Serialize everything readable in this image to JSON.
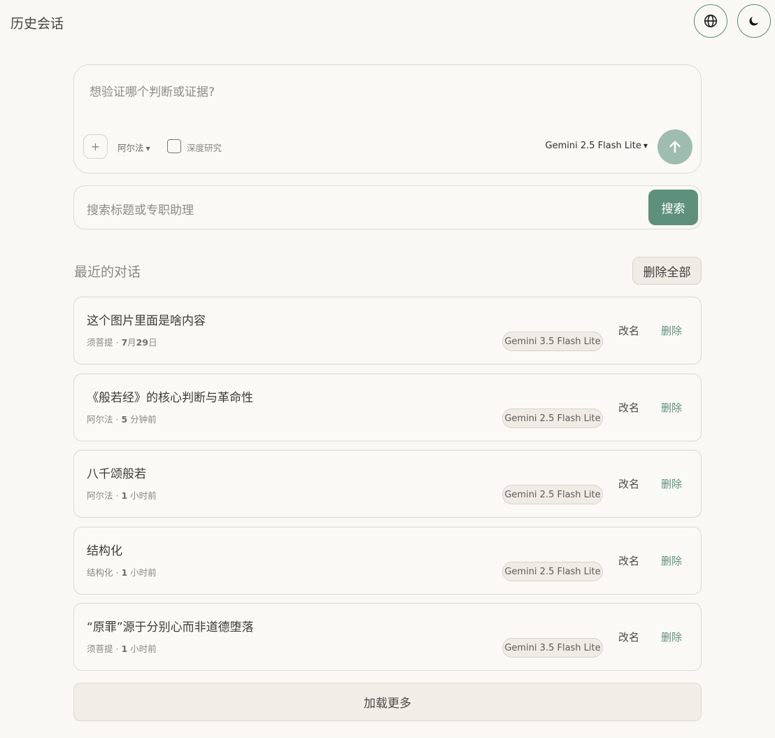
{
  "header": {
    "title": "历史会话",
    "lang_icon": "globe-icon",
    "theme_icon": "moon-icon"
  },
  "composer": {
    "placeholder": "想验证哪个判断或证据?",
    "attach_label": "+",
    "assistant": "阿尔法",
    "deep_research_label": "深度研究",
    "deep_research_checked": false,
    "model": "Gemini 2.5 Flash Lite",
    "send_icon": "arrow-up-icon"
  },
  "search": {
    "placeholder": "搜索标题或专职助理",
    "button_label": "搜索"
  },
  "recent": {
    "title": "最近的对话",
    "delete_all_label": "删除全部",
    "rename_label": "改名",
    "delete_label": "删除",
    "items": [
      {
        "title": "这个图片里面是啥内容",
        "assistant": "须菩提",
        "sep": " · ",
        "time_num": "7",
        "time_mid": "月",
        "time_num2": "29",
        "time_unit": "日",
        "model": "Gemini 3.5 Flash Lite"
      },
      {
        "title": "《般若经》的核心判断与革命性",
        "assistant": "阿尔法",
        "sep": " · ",
        "time_num": "5",
        "time_mid": "",
        "time_num2": "",
        "time_unit": " 分钟前",
        "model": "Gemini 2.5 Flash Lite"
      },
      {
        "title": "八千颂般若",
        "assistant": "阿尔法",
        "sep": " · ",
        "time_num": "1",
        "time_mid": "",
        "time_num2": "",
        "time_unit": " 小时前",
        "model": "Gemini 2.5 Flash Lite"
      },
      {
        "title": "结构化",
        "assistant": "结构化",
        "sep": " · ",
        "time_num": "1",
        "time_mid": "",
        "time_num2": "",
        "time_unit": " 小时前",
        "model": "Gemini 2.5 Flash Lite"
      },
      {
        "title": "“原罪”源于分别心而非道德堕落",
        "assistant": "须菩提",
        "sep": " · ",
        "time_num": "1",
        "time_mid": "",
        "time_num2": "",
        "time_unit": " 小时前",
        "model": "Gemini 3.5 Flash Lite"
      }
    ]
  },
  "load_more_label": "加载更多"
}
